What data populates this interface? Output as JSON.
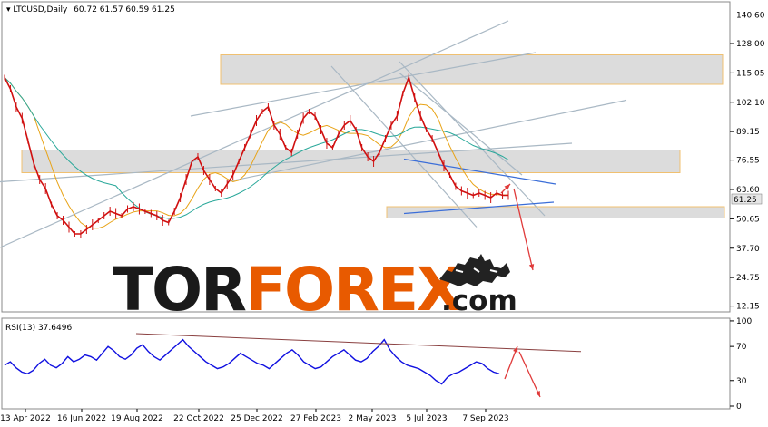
{
  "header": {
    "symbol": "LTCUSD,Daily",
    "ohlc": "60.72 61.57 60.59 61.25",
    "last_price": "61.25"
  },
  "rsi_header": "RSI(13) 37.6496",
  "logo": {
    "part1": "TOR",
    "part2": "FOREX",
    "part3": ".com"
  },
  "colors": {
    "candle": "#d01010",
    "ma_short": "#e8a316",
    "ma_long": "#2aa89a",
    "trend_blue": "#3b6ed8",
    "channel_gray": "#a9b8c4",
    "zone_fill": "#dcdcdc",
    "zone_border": "#f0c070",
    "arrow": "#e03a3a",
    "rsi_line": "#1010e0",
    "rsi_trend": "#8a4040",
    "logo_dark": "#1a1a1a",
    "logo_accent": "#e85a00"
  },
  "chart_data": {
    "type": "line",
    "title": "LTCUSD,Daily",
    "ylim": [
      10.0,
      146.0
    ],
    "y_ticks": [
      "140.60",
      "128.00",
      "115.05",
      "102.10",
      "89.15",
      "76.55",
      "63.60",
      "50.65",
      "37.70",
      "24.75",
      "12.15"
    ],
    "x_ticks": [
      "13 Apr 2022",
      "16 Jun 2022",
      "19 Aug 2022",
      "22 Oct 2022",
      "25 Dec 2022",
      "27 Feb 2023",
      "2 May 2023",
      "5 Jul 2023",
      "7 Sep 2023"
    ],
    "series": [
      {
        "values": [
          113,
          108,
          100,
          95,
          85,
          75,
          68,
          64,
          57,
          52,
          50,
          47,
          44,
          44,
          46,
          48,
          50,
          52,
          54,
          53,
          52,
          55,
          56,
          55,
          54,
          53,
          52,
          50,
          49,
          54,
          60,
          68,
          76,
          78,
          72,
          68,
          64,
          62,
          66,
          70,
          76,
          82,
          88,
          94,
          98,
          100,
          92,
          88,
          82,
          80,
          88,
          95,
          98,
          96,
          90,
          84,
          82,
          88,
          92,
          94,
          90,
          82,
          78,
          76,
          80,
          86,
          92,
          96,
          106,
          113,
          104,
          96,
          90,
          86,
          80,
          74,
          70,
          65,
          63,
          62,
          61,
          62,
          61,
          60,
          62,
          61,
          61
        ]
      }
    ],
    "zones": [
      {
        "from": 110.0,
        "to": 123.0
      },
      {
        "from": 71.0,
        "to": 81.0
      },
      {
        "from": 51.0,
        "to": 56.0
      }
    ],
    "rsi": {
      "title": "RSI(13) 37.6496",
      "ylim": [
        0,
        100
      ],
      "y_ticks": [
        "100",
        "70",
        "30",
        "0"
      ],
      "values": [
        48,
        52,
        45,
        40,
        38,
        42,
        50,
        55,
        48,
        45,
        50,
        58,
        52,
        55,
        60,
        58,
        54,
        62,
        70,
        65,
        58,
        55,
        60,
        68,
        72,
        64,
        58,
        54,
        60,
        66,
        72,
        78,
        70,
        64,
        58,
        52,
        48,
        44,
        46,
        50,
        56,
        62,
        58,
        54,
        50,
        48,
        44,
        50,
        56,
        62,
        66,
        60,
        52,
        48,
        44,
        46,
        52,
        58,
        62,
        66,
        60,
        54,
        52,
        56,
        64,
        70,
        78,
        66,
        58,
        52,
        48,
        46,
        44,
        40,
        36,
        30,
        26,
        34,
        38,
        40,
        44,
        48,
        52,
        50,
        44,
        40,
        38
      ]
    }
  }
}
